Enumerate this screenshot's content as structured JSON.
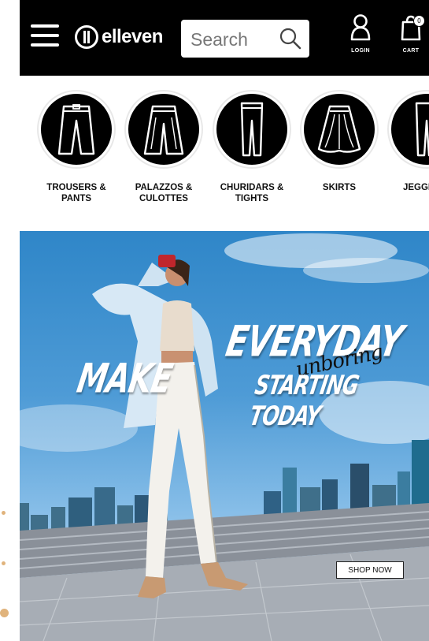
{
  "header": {
    "brand": "elleven",
    "search_placeholder": "Search",
    "login_label": "LOGIN",
    "cart_label": "CART",
    "cart_count": "0"
  },
  "categories": [
    {
      "label": "TROUSERS &\nPANTS",
      "icon": "trousers-icon"
    },
    {
      "label": "PALAZZOS &\nCULOTTES",
      "icon": "palazzo-icon"
    },
    {
      "label": "CHURIDARS &\nTIGHTS",
      "icon": "tights-icon"
    },
    {
      "label": "SKIRTS",
      "icon": "skirt-icon"
    },
    {
      "label": "JEGGINGS",
      "icon": "jeggings-icon"
    }
  ],
  "banner": {
    "line1": "MAKE",
    "line2": "EVERYDAY",
    "script": "unboring",
    "line3": "STARTING TODAY",
    "cta": "SHOP NOW"
  },
  "colors": {
    "header_bg": "#000000",
    "accent_dots": "#e0b37c",
    "sky": "#4e9bd6"
  }
}
